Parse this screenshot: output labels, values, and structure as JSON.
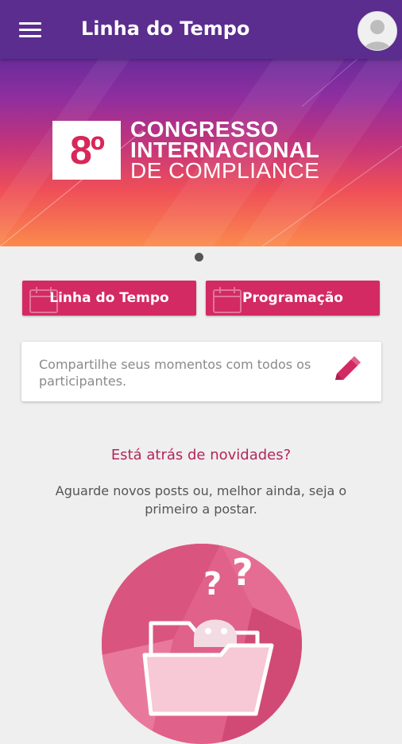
{
  "appbar": {
    "title": "Linha do Tempo"
  },
  "banner": {
    "logo_number": "8º",
    "logo_line1": "CONGRESSO",
    "logo_line2": "INTERNACIONAL",
    "logo_line3": "DE COMPLIANCE",
    "gradient_colors": [
      "#6a2c9a",
      "#c2347c",
      "#fb8a4d"
    ]
  },
  "actions": {
    "timeline_label": "Linha do Tempo",
    "program_label": "Programação"
  },
  "compose": {
    "placeholder": "Compartilhe seus momentos com todos os participantes."
  },
  "empty_state": {
    "title": "Está atrás de novidades?",
    "subtitle": "Aguarde novos posts ou, melhor ainda, seja o primeiro a postar."
  },
  "colors": {
    "appbar": "#5b2d8e",
    "accent": "#d32a63",
    "title_text": "#b3265a"
  },
  "icons": [
    "menu-icon",
    "avatar-icon",
    "calendar-icon",
    "edit-icon",
    "folder-question-icon"
  ]
}
